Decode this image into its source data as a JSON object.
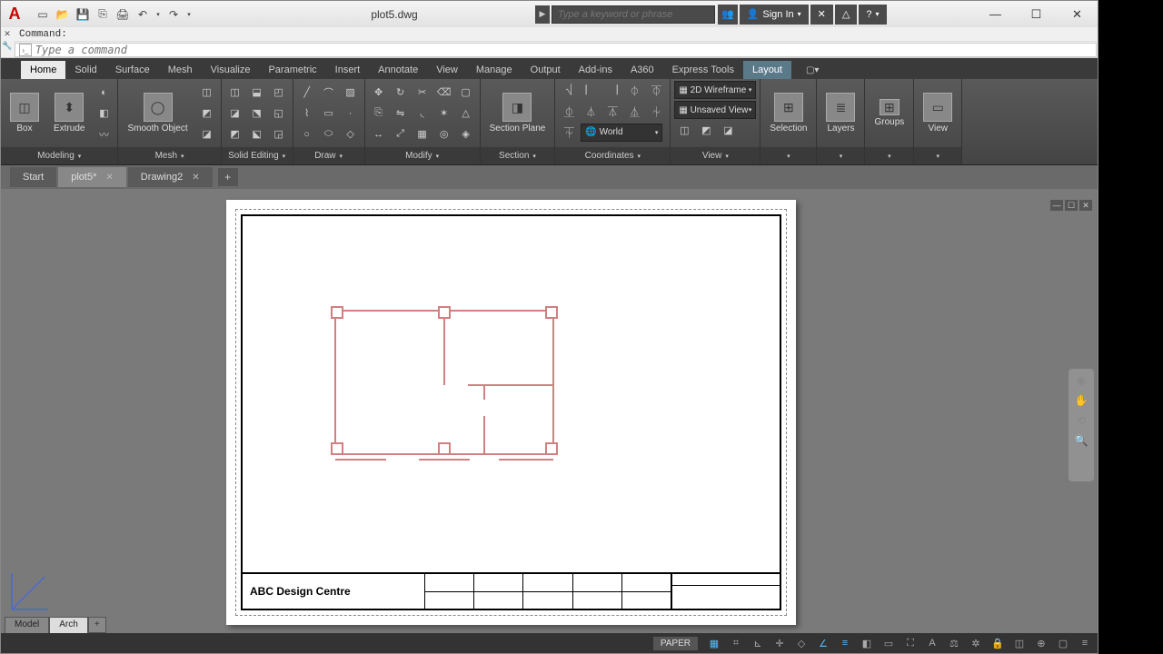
{
  "title": "plot5.dwg",
  "search": {
    "placeholder": "Type a keyword or phrase"
  },
  "signIn": "Sign In",
  "command": {
    "output": "Command:",
    "placeholder": "Type a command"
  },
  "ribbonTabs": [
    "Home",
    "Solid",
    "Surface",
    "Mesh",
    "Visualize",
    "Parametric",
    "Insert",
    "Annotate",
    "View",
    "Manage",
    "Output",
    "Add-ins",
    "A360",
    "Express Tools",
    "Layout"
  ],
  "panels": {
    "modeling": {
      "title": "Modeling",
      "box": "Box",
      "extrude": "Extrude"
    },
    "mesh": {
      "title": "Mesh",
      "smooth": "Smooth Object"
    },
    "solidEditing": {
      "title": "Solid Editing"
    },
    "draw": {
      "title": "Draw"
    },
    "modify": {
      "title": "Modify"
    },
    "section": {
      "title": "Section",
      "plane": "Section Plane"
    },
    "coordinates": {
      "title": "Coordinates",
      "world": "World"
    },
    "view": {
      "title": "View",
      "wireframe": "2D Wireframe",
      "unsaved": "Unsaved View"
    },
    "selection": {
      "title": "Selection"
    },
    "layers": {
      "title": "Layers"
    },
    "groups": {
      "title": "Groups"
    },
    "viewPanel": {
      "title": "View"
    }
  },
  "fileTabs": {
    "start": "Start",
    "plot5": "plot5*",
    "drawing2": "Drawing2"
  },
  "titleblock": {
    "company": "ABC Design Centre"
  },
  "layoutTabs": {
    "model": "Model",
    "arch": "Arch"
  },
  "status": {
    "paper": "PAPER"
  }
}
